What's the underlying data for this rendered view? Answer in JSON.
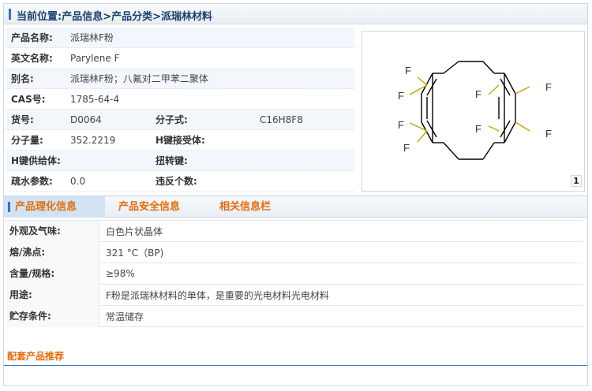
{
  "breadcrumb": "当前位置:产品信息>产品分类>派瑞林材料",
  "product": {
    "name_label": "产品名称:",
    "name_value": "派瑞林F粉",
    "en_label": "英文名称:",
    "en_value": "Parylene F",
    "alias_label": "别名:",
    "alias_value": "派瑞林F粉；八氟对二甲苯二聚体",
    "cas_label": "CAS号:",
    "cas_value": "1785-64-4",
    "code_label": "货号:",
    "code_value": "D0064",
    "formula_label": "分子式:",
    "formula_value": "C16H8F8",
    "mw_label": "分子量:",
    "mw_value": "352.2219",
    "hacc_label": "H键接受体:",
    "hacc_value": "",
    "hdon_label": "H键供给体:",
    "hdon_value": "",
    "rot_label": "扭转键:",
    "rot_value": "",
    "logp_label": "疏水参数:",
    "logp_value": "0.0",
    "viol_label": "违反个数:",
    "viol_value": ""
  },
  "structure": {
    "atom_labels": [
      "F",
      "F",
      "F",
      "F",
      "F",
      "F",
      "F",
      "F"
    ],
    "page_number": "1"
  },
  "tabs": {
    "physchem": "产品理化信息",
    "safety": "产品安全信息",
    "related": "相关信息栏"
  },
  "properties": [
    {
      "label": "外观及气味:",
      "value": "白色片状晶体"
    },
    {
      "label": "熔/沸点:",
      "value": "321 °C（BP)"
    },
    {
      "label": "含量/规格:",
      "value": "≥98%"
    },
    {
      "label": "用途:",
      "value": "F粉是派瑞林材料的单体，是重要的光电材料光电材料"
    },
    {
      "label": "贮存条件:",
      "value": "常温储存"
    }
  ],
  "recommend_label": "配套产品推荐",
  "colors": {
    "accent_orange": "#e36c0a",
    "accent_blue": "#2f73c7",
    "fluorine_bond": "#c8a200"
  }
}
